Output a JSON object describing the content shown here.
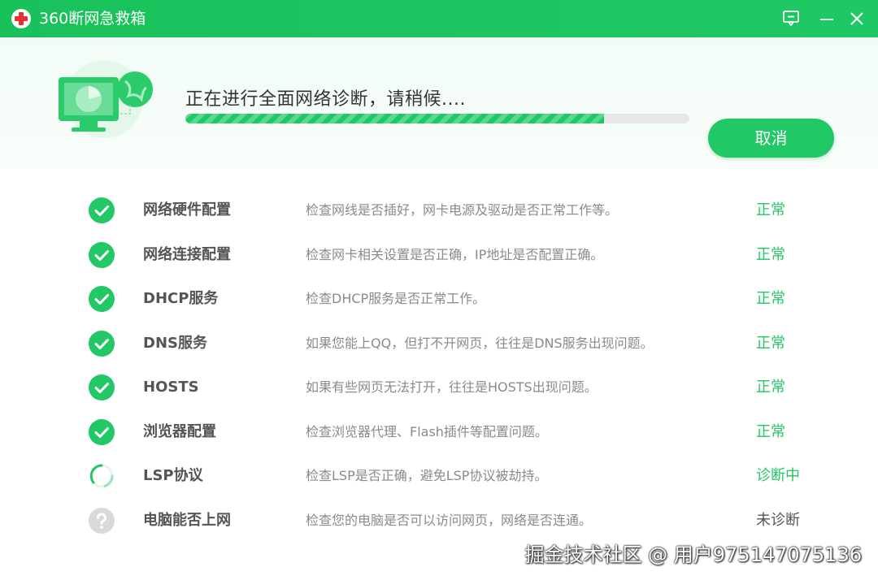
{
  "app": {
    "title": "360断网急救箱"
  },
  "titlebar": {
    "icons": [
      "feedback-icon",
      "minimize-icon",
      "close-icon"
    ]
  },
  "header": {
    "status_text": "正在进行全面网络诊断，请稍候....",
    "progress_percent": 83,
    "cancel_label": "取消"
  },
  "colors": {
    "accent": "#1ec864",
    "status_ok": "#22c766",
    "status_pending": "#555555",
    "pending_icon": "#d9d9d9"
  },
  "items": [
    {
      "name": "网络硬件配置",
      "desc": "检查网线是否插好，网卡电源及驱动是否正常工作等。",
      "status": "正常",
      "state": "ok"
    },
    {
      "name": "网络连接配置",
      "desc": "检查网卡相关设置是否正确，IP地址是否配置正确。",
      "status": "正常",
      "state": "ok"
    },
    {
      "name": "DHCP服务",
      "desc": "检查DHCP服务是否正常工作。",
      "status": "正常",
      "state": "ok"
    },
    {
      "name": "DNS服务",
      "desc": "如果您能上QQ，但打不开网页，往往是DNS服务出现问题。",
      "status": "正常",
      "state": "ok"
    },
    {
      "name": "HOSTS",
      "desc": "如果有些网页无法打开，往往是HOSTS出现问题。",
      "status": "正常",
      "state": "ok"
    },
    {
      "name": "浏览器配置",
      "desc": "检查浏览器代理、Flash插件等配置问题。",
      "status": "正常",
      "state": "ok"
    },
    {
      "name": "LSP协议",
      "desc": "检查LSP是否正确，避免LSP协议被劫持。",
      "status": "诊断中",
      "state": "running"
    },
    {
      "name": "电脑能否上网",
      "desc": "检查您的电脑是否可以访问网页，网络是否连通。",
      "status": "未诊断",
      "state": "pending"
    }
  ],
  "watermark": "掘金技术社区 @ 用户975147075136"
}
